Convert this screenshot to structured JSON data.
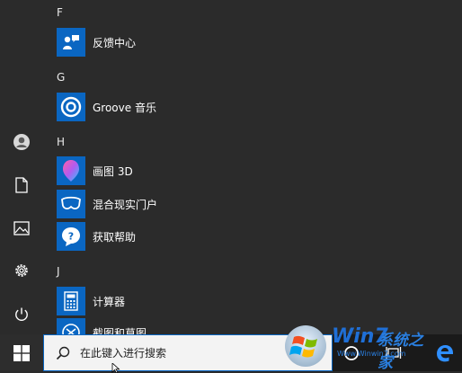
{
  "rail": {
    "items": [
      {
        "name": "user",
        "icon": "user-icon"
      },
      {
        "name": "documents",
        "icon": "document-icon"
      },
      {
        "name": "pictures",
        "icon": "picture-icon"
      },
      {
        "name": "settings",
        "icon": "gear-icon"
      },
      {
        "name": "power",
        "icon": "power-icon"
      }
    ]
  },
  "apps": {
    "groups": [
      {
        "letter": "F",
        "items": [
          {
            "label": "反馈中心",
            "icon": "feedback-icon"
          }
        ]
      },
      {
        "letter": "G",
        "items": [
          {
            "label": "Groove 音乐",
            "icon": "groove-music-icon"
          }
        ]
      },
      {
        "letter": "H",
        "items": [
          {
            "label": "画图 3D",
            "icon": "paint-3d-icon"
          },
          {
            "label": "混合现实门户",
            "icon": "mixed-reality-icon"
          },
          {
            "label": "获取帮助",
            "icon": "get-help-icon"
          }
        ]
      },
      {
        "letter": "J",
        "items": [
          {
            "label": "计算器",
            "icon": "calculator-icon"
          },
          {
            "label": "截图和草图",
            "icon": "snip-sketch-icon"
          }
        ]
      }
    ]
  },
  "taskbar": {
    "search_placeholder": "在此键入进行搜索",
    "search_icon": "search-icon",
    "start_icon": "windows-logo-icon",
    "cortana_icon": "cortana-icon",
    "task_view_icon": "task-view-icon",
    "edge_icon": "edge-icon"
  },
  "watermark": {
    "brand": "Win7",
    "suffix": "系统之家",
    "url": "Www.Winwin7.com",
    "colors": {
      "win": "#1f6fd6",
      "seven": "#f2b705",
      "cn": "#2a7fe0"
    }
  },
  "colors": {
    "accent": "#0a66c2",
    "menu_bg": "#2b2b2b",
    "taskbar_bg": "#1a1a1a"
  }
}
